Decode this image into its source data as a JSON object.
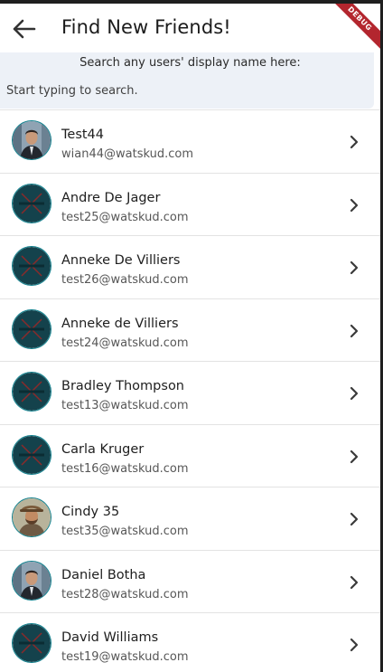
{
  "header": {
    "title": "Find New Friends!",
    "back_icon": "arrow-left-icon",
    "debug_banner": "DEBUG",
    "debug_color": "#b3262e"
  },
  "search": {
    "label": "Search any users' display name here:",
    "placeholder": "Start typing to search.",
    "value": ""
  },
  "colors": {
    "avatar_ring": "#0e7f8c",
    "placeholder_avatar_bg": "#14424c",
    "search_panel_bg": "#edf1f7"
  },
  "users": [
    {
      "name": "Test44",
      "email": "wian44@watskud.com",
      "avatar": "photo-man-suit"
    },
    {
      "name": "Andre De Jager",
      "email": "test25@watskud.com",
      "avatar": "default"
    },
    {
      "name": "Anneke De Villiers",
      "email": "test26@watskud.com",
      "avatar": "default"
    },
    {
      "name": "Anneke de Villiers",
      "email": "test24@watskud.com",
      "avatar": "default"
    },
    {
      "name": "Bradley Thompson",
      "email": "test13@watskud.com",
      "avatar": "default"
    },
    {
      "name": "Carla Kruger",
      "email": "test16@watskud.com",
      "avatar": "default"
    },
    {
      "name": "Cindy 35",
      "email": "test35@watskud.com",
      "avatar": "photo-bearded-man"
    },
    {
      "name": "Daniel Botha",
      "email": "test28@watskud.com",
      "avatar": "photo-man-suit"
    },
    {
      "name": "David Williams",
      "email": "test19@watskud.com",
      "avatar": "default"
    }
  ],
  "row_icon": "chevron-right-icon"
}
